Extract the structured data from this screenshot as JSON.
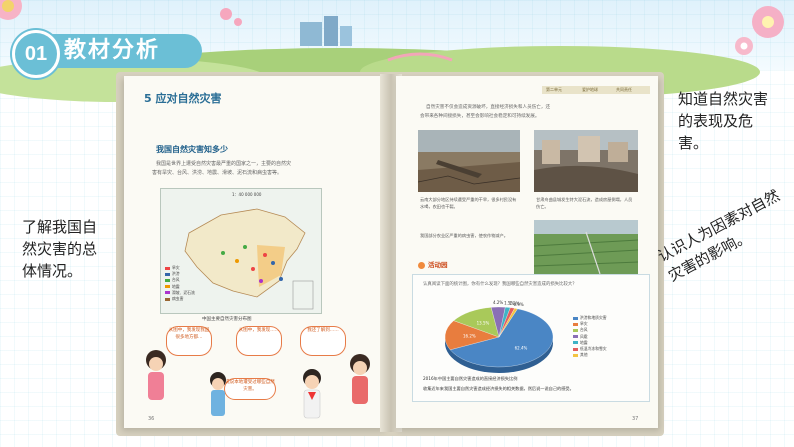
{
  "header": {
    "number": "01",
    "title": "教材分析"
  },
  "left_page": {
    "lesson_title": "5  应对自然灾害",
    "subheading": "我国自然灾害知多少",
    "intro_line1": "我国是世界上遭受自然灾害最严重的国家之一，主要的自然灾",
    "intro_line2": "害有旱灾、台风、洪涝、地震、滑坡、泥石流和病虫害等。",
    "map_scale": "1：40 000 000",
    "map_caption": "中国主要自然灾害分布图",
    "legend": [
      "旱灾",
      "洪涝",
      "台风",
      "地震",
      "滑坡、泥石流",
      "病虫害"
    ],
    "bubbles": [
      "从图中，我发现我国很多地方都…",
      "从图中，我发现……",
      "我还了解到……"
    ],
    "bottom_bubble": "说说本地遭受过哪些自然灾害。",
    "page_number": "36"
  },
  "right_page": {
    "header_tags": [
      "第二单元",
      "爱护地球",
      "共同责任"
    ],
    "intro_line1": "自然灾害不仅会造成资源破坏，直接经济损失和人员伤亡，还",
    "intro_line2": "会带来各种间接损失，甚至会影响社会稳定和可持续发展。",
    "photo_captions": [
      "云南大部分地区持续遭受严重的干旱，很多村民没有水喝，农田也干裂。",
      "甘肃舟曲县城发生特大泥石流，造成房屋倒塌，人员伤亡。",
      "我国部分农业区严重的病虫害，使农作物减产。"
    ],
    "activity_title": "活动园",
    "activity_text": "认真阅读下面的统计图，你有什么发现？我国哪些自然灾害造成的损失比较大？",
    "pie_caption": "2016年中国主要自然灾害造成的直接经济损失比例",
    "pie_footer": "收集近年来我国主要自然灾害造成经济损失的相关数据，然后说一说自己的感受。",
    "page_number": "37"
  },
  "notes": {
    "left": "了解我国自然灾害的总体情况。",
    "right_top": "知道自然灾害的表现及危害。",
    "right_rotated": "认识人为因素对自然灾害的影响。"
  },
  "chart_data": {
    "type": "pie",
    "title": "2016年中国主要自然灾害造成的直接经济损失比例",
    "categories": [
      "洪涝和地质灾害",
      "旱灾",
      "台风",
      "风雹",
      "地震",
      "低温冷冻和雪灾",
      "其他"
    ],
    "values": [
      62.4,
      16.2,
      13.5,
      4.2,
      1.5,
      1.3,
      0.9
    ],
    "colors": [
      "#4a86c5",
      "#e87d3e",
      "#a9c95a",
      "#8a6fb5",
      "#3fb3c6",
      "#e35d5d",
      "#f3c443"
    ]
  }
}
